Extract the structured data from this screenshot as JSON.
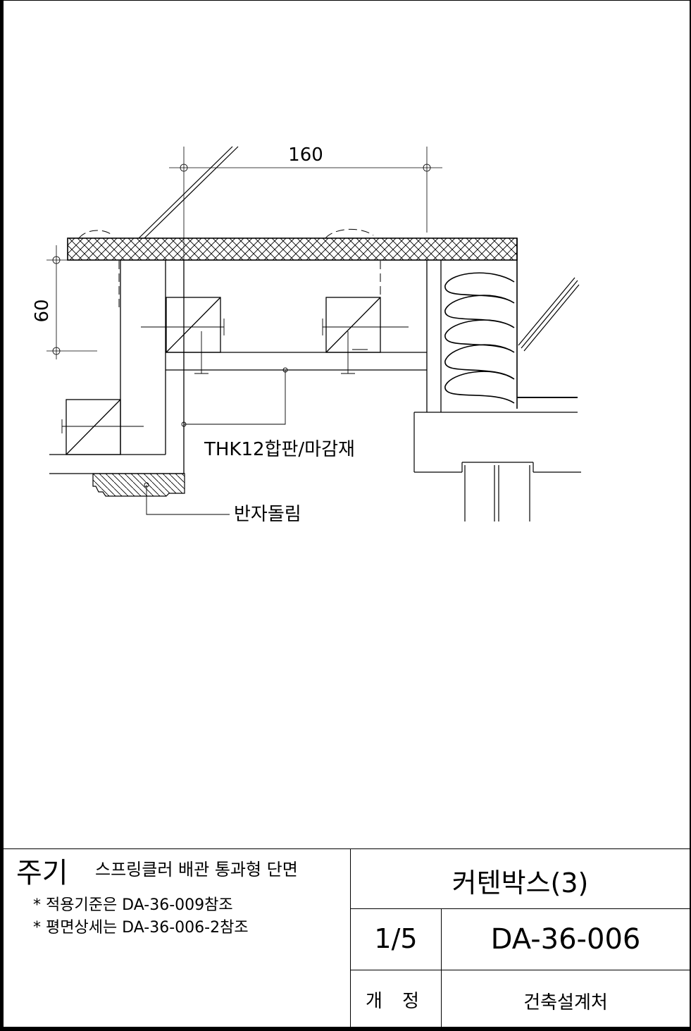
{
  "drawing": {
    "dim_width": "160",
    "dim_height": "60",
    "label_plywood": "THK12합판/마감재",
    "label_molding": "반자돌림"
  },
  "title_block": {
    "notes_heading": "주기",
    "notes_title": "스프링클러 배관 통과형 단면",
    "note_1": "* 적용기준은 DA-36-009참조",
    "note_2": "* 평면상세는 DA-36-006-2참조",
    "drawing_name": "커텐박스(3)",
    "sheet_number": "1/5",
    "drawing_number": "DA-36-006",
    "revision_label": "개 정",
    "department": "건축설계처"
  }
}
